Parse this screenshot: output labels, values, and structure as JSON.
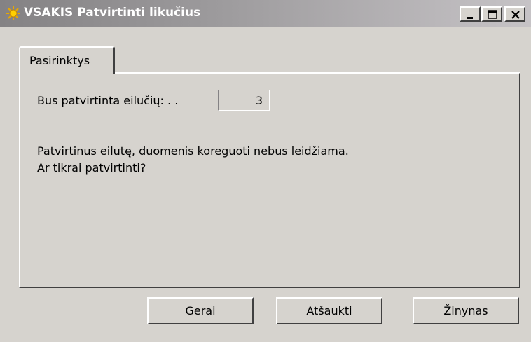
{
  "window": {
    "title": "VSAKIS Patvirtinti likučius",
    "icon": "sun-icon",
    "controls": [
      "minimize-icon",
      "maximize-icon",
      "close-icon"
    ]
  },
  "tabs": [
    {
      "label": "Pasirinktys",
      "active": true
    }
  ],
  "form": {
    "rows_label": "Bus patvirtinta eilučių: .  .",
    "rows_value": "3"
  },
  "message": {
    "line1": "Patvirtinus eilutę, duomenis koreguoti nebus leidžiama.",
    "line2": "Ar tikrai patvirtinti?"
  },
  "buttons": {
    "ok": "Gerai",
    "cancel": "Atšaukti",
    "help": "Žinynas"
  },
  "colors": {
    "dialog_bg": "#d6d3ce",
    "titlebar_start": "#848284",
    "titlebar_end": "#c6c3c6"
  }
}
